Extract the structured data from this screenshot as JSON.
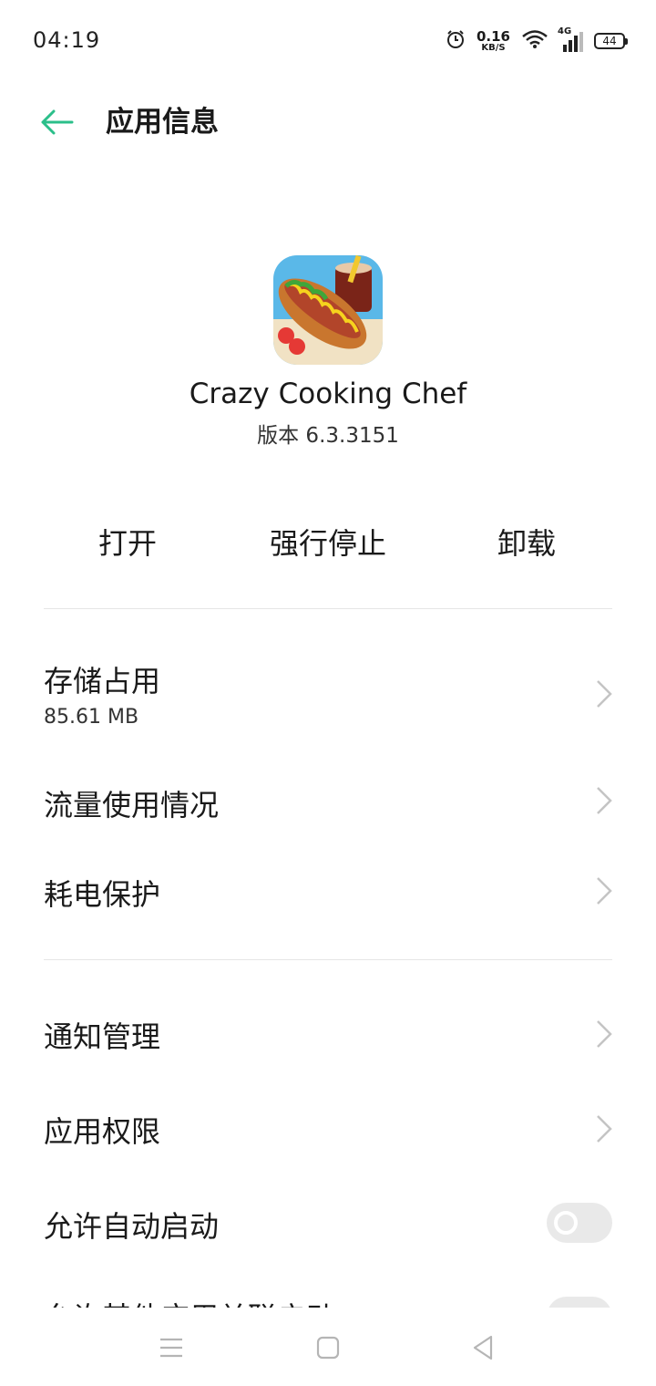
{
  "status_bar": {
    "time": "04:19",
    "net_speed_value": "0.16",
    "net_speed_unit": "KB/S",
    "signal_label": "4G",
    "battery_level": "44"
  },
  "header": {
    "title": "应用信息"
  },
  "app": {
    "name": "Crazy Cooking Chef",
    "version": "版本 6.3.3151"
  },
  "actions": {
    "open": "打开",
    "force_stop": "强行停止",
    "uninstall": "卸载"
  },
  "settings": {
    "storage_label": "存储占用",
    "storage_value": "85.61 MB",
    "data_usage_label": "流量使用情况",
    "battery_protect_label": "耗电保护",
    "notification_label": "通知管理",
    "permissions_label": "应用权限",
    "auto_start_label": "允许自动启动",
    "cutoff_label": "允许其他应用关联启动"
  },
  "colors": {
    "accent": "#2bbf8a",
    "text": "#1a1a1a",
    "chevron": "#c4c4c4",
    "toggle_off": "#e9e9e9"
  }
}
